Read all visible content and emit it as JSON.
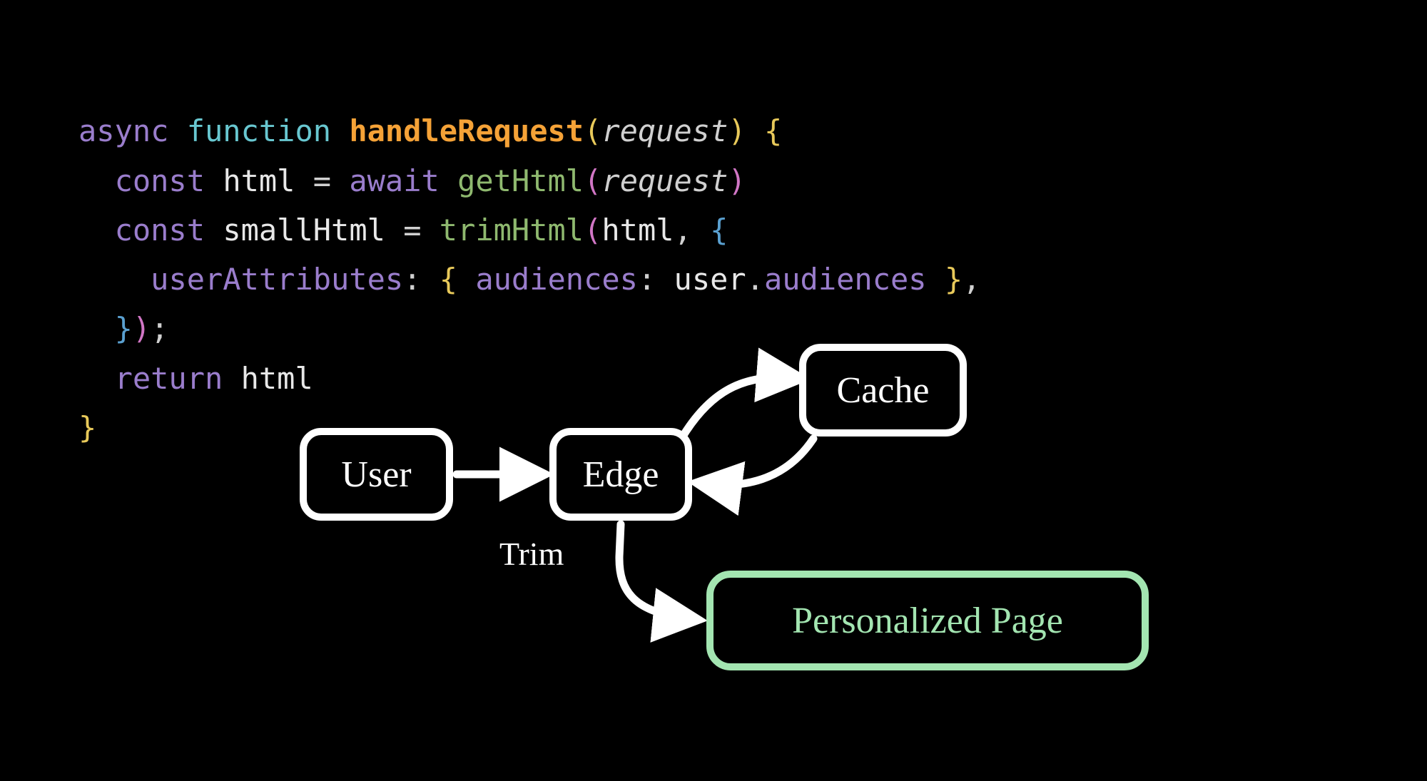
{
  "code": {
    "async": "async",
    "function": "function",
    "fn_name": "handleRequest",
    "param_request": "request",
    "const1": "const",
    "var_html": "html",
    "eq": "=",
    "await": "await",
    "getHtml": "getHtml",
    "const2": "const",
    "var_smallHtml": "smallHtml",
    "trimHtml": "trimHtml",
    "arg_html": "html",
    "userAttributes": "userAttributes",
    "audiences_key": "audiences",
    "user": "user",
    "dot": ".",
    "audiences_prop": "audiences",
    "return": "return",
    "ret_html": "html"
  },
  "diagram": {
    "user": "User",
    "edge": "Edge",
    "cache": "Cache",
    "trim": "Trim",
    "personalized": "Personalized Page"
  },
  "colors": {
    "bg": "#000000",
    "node_border": "#ffffff",
    "pp_green": "#a3e5b1"
  }
}
